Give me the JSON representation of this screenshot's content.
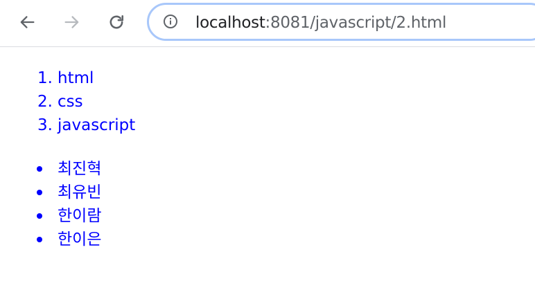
{
  "browser": {
    "url_host": "localhost",
    "url_path": ":8081/javascript/2.html",
    "colors": {
      "omnibox_border": "#a8c7fa",
      "link_text": "#0000ff"
    },
    "icons": {
      "back": "arrow-left-icon",
      "forward": "arrow-right-icon",
      "reload": "reload-icon",
      "site_info": "info-icon"
    }
  },
  "page": {
    "ordered_list": [
      {
        "marker": "1.",
        "label": "html"
      },
      {
        "marker": "2.",
        "label": "css"
      },
      {
        "marker": "3.",
        "label": "javascript"
      }
    ],
    "unordered_list": [
      {
        "label": "최진혁"
      },
      {
        "label": "최유빈"
      },
      {
        "label": "한이람"
      },
      {
        "label": "한이은"
      }
    ]
  }
}
